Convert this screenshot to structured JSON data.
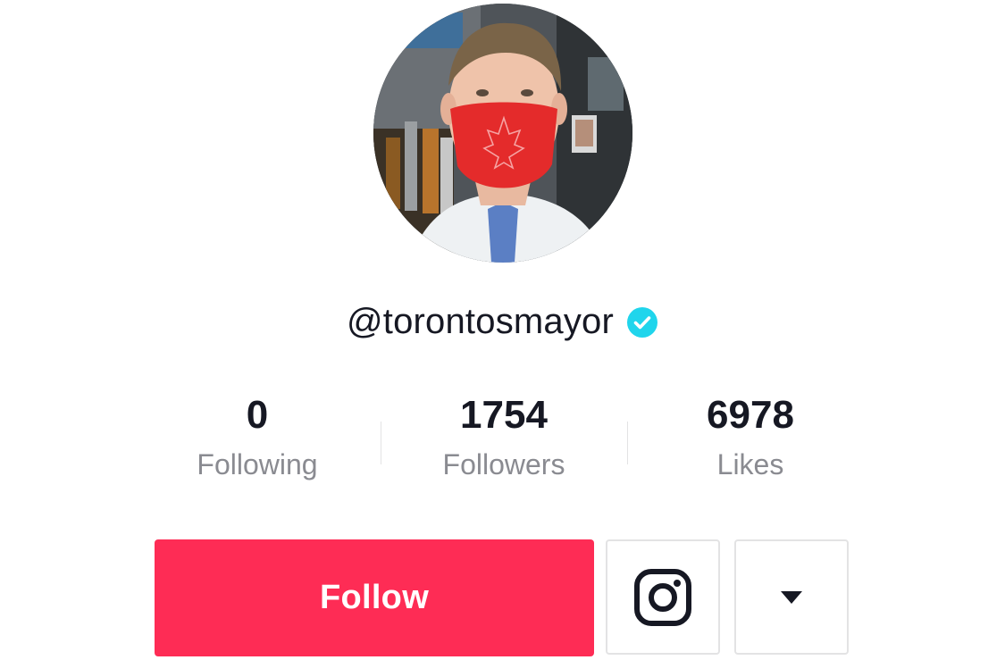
{
  "profile": {
    "username": "@torontosmayor",
    "verified_icon": "verified-badge-icon",
    "avatar_icon": "profile-photo"
  },
  "stats": [
    {
      "value": "0",
      "label": "Following"
    },
    {
      "value": "1754",
      "label": "Followers"
    },
    {
      "value": "6978",
      "label": "Likes"
    }
  ],
  "actions": {
    "follow_label": "Follow",
    "instagram_icon": "instagram-icon",
    "more_icon": "caret-down-icon"
  },
  "colors": {
    "follow_button": "#fe2c55",
    "verified_badge": "#20d5ec",
    "primary_text": "#161823",
    "secondary_text": "#8a8b91",
    "border": "#e3e3e4"
  }
}
